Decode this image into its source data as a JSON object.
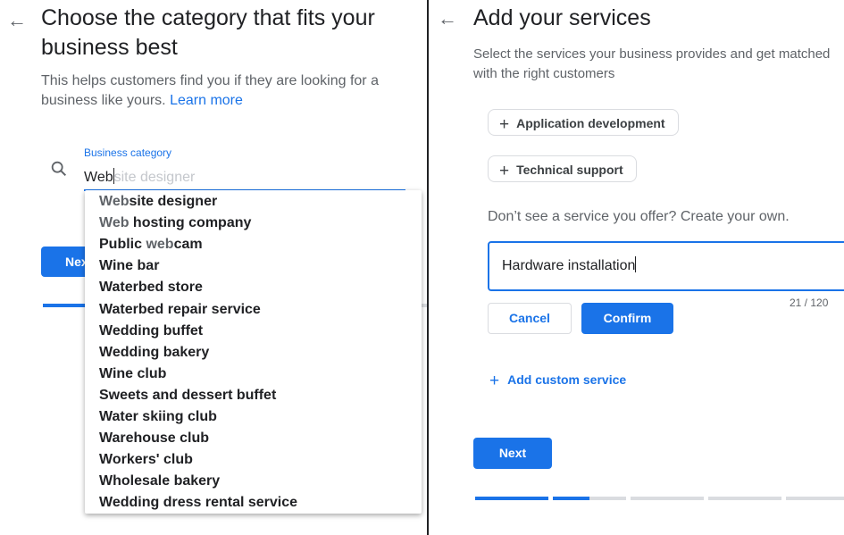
{
  "left": {
    "title": "Choose the category that fits your business best",
    "description": "This helps customers find you if they are looking for a business like yours.",
    "learn_more": "Learn more",
    "field_label": "Business category",
    "typed": "Web",
    "hint": "site designer",
    "next_label": "Next",
    "suggestions": [
      [
        "Web",
        "site designer"
      ],
      [
        "Web",
        " hosting company"
      ],
      [
        "Public ",
        "web",
        "cam"
      ],
      [
        "Wine bar"
      ],
      [
        "Waterbed store"
      ],
      [
        "Waterbed repair service"
      ],
      [
        "Wedding buffet"
      ],
      [
        "Wedding bakery"
      ],
      [
        "Wine club"
      ],
      [
        "Sweets and dessert buffet"
      ],
      [
        "Water skiing club"
      ],
      [
        "Warehouse club"
      ],
      [
        "Workers' club"
      ],
      [
        "Wholesale bakery"
      ],
      [
        "Wedding dress rental service"
      ]
    ]
  },
  "right": {
    "title": "Add your services",
    "description": "Select the services your business provides and get matched with the right customers",
    "chips": [
      "Application development",
      "Technical support"
    ],
    "own_label": "Don’t see a service you offer? Create your own.",
    "input_value": "Hardware installation",
    "counter": "21 / 120",
    "cancel": "Cancel",
    "confirm": "Confirm",
    "add_custom": "Add custom service",
    "next_label": "Next"
  },
  "icons": {
    "back": "back-arrow-icon",
    "search": "search-icon",
    "plus": "plus-icon"
  },
  "colors": {
    "accent": "#1a73e8",
    "track": "#dadce0",
    "text": "#202124",
    "secondary": "#5f6368"
  },
  "progress": {
    "left_step_complete": true,
    "right_steps_done": 2
  }
}
